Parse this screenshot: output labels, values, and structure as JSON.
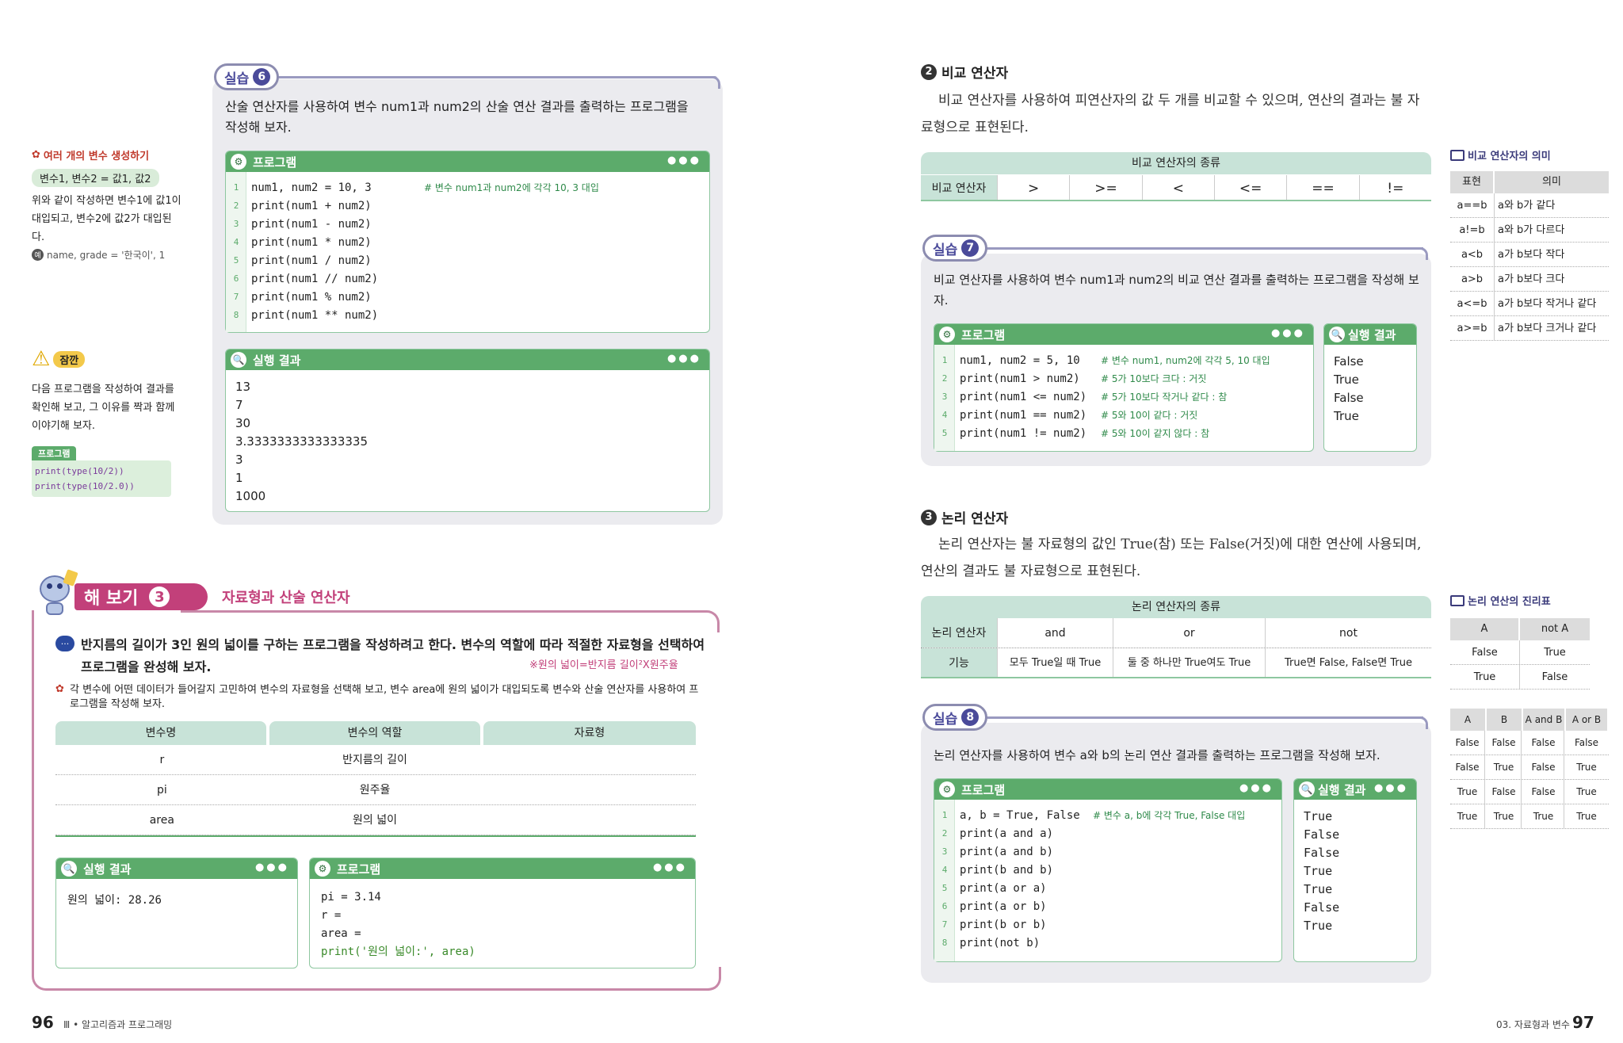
{
  "left_page": {
    "page_number": "96",
    "footer": "Ⅲ • 알고리즘과 프로그래밍",
    "sidebar_tip": {
      "title": "여러 개의 변수 생성하기",
      "syntax": "변수1, 변수2 = 값1, 값2",
      "text": "위와 같이 작성하면 변수1에 값1이 대입되고, 변수2에 값2가 대입된다.",
      "example_label": "예",
      "example": "name, grade = '한국이', 1"
    },
    "sidebar_wait": {
      "title": "잠깐",
      "text": "다음 프로그램을 작성하여 결과를 확인해 보고, 그 이유를 짝과 함께 이야기해 보자.",
      "program_label": "프로그램",
      "code": [
        "print(type(10/2))",
        "print(type(10/2.0))"
      ]
    },
    "practice6": {
      "tag": "실습",
      "num": "6",
      "description": "산술 연산자를 사용하여 변수 num1과 num2의 산술 연산 결과를 출력하는 프로그램을 작성해 보자.",
      "program_label": "프로그램",
      "code": [
        {
          "n": "1",
          "text": "num1, num2 = 10, 3",
          "comment": "# 변수 num1과 num2에 각각 10, 3 대입"
        },
        {
          "n": "2",
          "text": "print(num1 + num2)",
          "comment": ""
        },
        {
          "n": "3",
          "text": "print(num1 - num2)",
          "comment": ""
        },
        {
          "n": "4",
          "text": "print(num1 * num2)",
          "comment": ""
        },
        {
          "n": "5",
          "text": "print(num1 / num2)",
          "comment": ""
        },
        {
          "n": "6",
          "text": "print(num1 // num2)",
          "comment": ""
        },
        {
          "n": "7",
          "text": "print(num1 % num2)",
          "comment": ""
        },
        {
          "n": "8",
          "text": "print(num1 ** num2)",
          "comment": ""
        }
      ],
      "result_label": "실행 결과",
      "result": [
        "13",
        "7",
        "30",
        "3.3333333333333335",
        "3",
        "1",
        "1000"
      ]
    },
    "tryit": {
      "label": "해 보기",
      "num": "3",
      "title": "자료형과 산술 연산자",
      "question": "반지름의 길이가 3인 원의 넓이를 구하는 프로그램을 작성하려고 한다. 변수의 역할에 따라 적절한 자료형을 선택하여 프로그램을 완성해 보자.",
      "note": "※원의 넓이=반지름 길이²X원주율",
      "instruction": "각 변수에 어떤 데이터가 들어갈지 고민하여 변수의 자료형을 선택해 보고, 변수 area에 원의 넓이가 대입되도록 변수와 산술 연산자를 사용하여 프로그램을 작성해 보자.",
      "table_headers": [
        "변수명",
        "변수의 역할",
        "자료형"
      ],
      "table_rows": [
        [
          "r",
          "반지름의 길이",
          ""
        ],
        [
          "pi",
          "원주율",
          ""
        ],
        [
          "area",
          "원의 넓이",
          ""
        ]
      ],
      "result_label": "실행 결과",
      "result": "원의 넓이: 28.26",
      "program_label": "프로그램",
      "code": [
        "pi = 3.14",
        "r =",
        "area =",
        "print('원의 넓이:', area)"
      ]
    }
  },
  "right_page": {
    "page_number": "97",
    "footer": "03. 자료형과 변수",
    "comparison": {
      "num": "2",
      "title": "비교 연산자",
      "paragraph": "비교 연산자를 사용하여 피연산자의 값 두 개를 비교할 수 있으며, 연산의 결과는 불 자료형으로 표현된다.",
      "table_title": "비교 연산자의 종류",
      "row_label": "비교 연산자",
      "operators": [
        ">",
        ">=",
        "<",
        "<=",
        "==",
        "!="
      ]
    },
    "practice7": {
      "tag": "실습",
      "num": "7",
      "description": "비교 연산자를 사용하여 변수 num1과 num2의 비교 연산 결과를 출력하는 프로그램을 작성해 보자.",
      "program_label": "프로그램",
      "code": [
        {
          "n": "1",
          "text": "num1, num2 = 5, 10",
          "comment": "# 변수 num1, num2에 각각 5, 10 대입"
        },
        {
          "n": "2",
          "text": "print(num1 > num2)",
          "comment": "# 5가 10보다 크다 : 거짓"
        },
        {
          "n": "3",
          "text": "print(num1 <= num2)",
          "comment": "# 5가 10보다 작거나 같다 : 참"
        },
        {
          "n": "4",
          "text": "print(num1 == num2)",
          "comment": "# 5와 10이 같다 : 거짓"
        },
        {
          "n": "5",
          "text": "print(num1 != num2)",
          "comment": "# 5와 10이 같지 않다 : 참"
        }
      ],
      "result_label": "실행 결과",
      "result": [
        "False",
        "True",
        "False",
        "True"
      ]
    },
    "logical": {
      "num": "3",
      "title": "논리 연산자",
      "paragraph": "논리 연산자는 불 자료형의 값인 True(참) 또는 False(거짓)에 대한 연산에 사용되며, 연산의 결과도 불 자료형으로 표현된다.",
      "table_title": "논리 연산자의 종류",
      "row1_label": "논리 연산자",
      "row2_label": "기능",
      "ops": [
        "and",
        "or",
        "not"
      ],
      "functions": [
        "모두 True일 때 True",
        "둘 중 하나만 True여도 True",
        "True면 False, False면 True"
      ]
    },
    "practice8": {
      "tag": "실습",
      "num": "8",
      "description": "논리 연산자를 사용하여 변수 a와 b의 논리 연산 결과를 출력하는 프로그램을 작성해 보자.",
      "program_label": "프로그램",
      "code": [
        {
          "n": "1",
          "text": "a, b = True, False",
          "comment": "# 변수 a, b에 각각 True, False 대입"
        },
        {
          "n": "2",
          "text": "print(a and a)",
          "comment": ""
        },
        {
          "n": "3",
          "text": "print(a and b)",
          "comment": ""
        },
        {
          "n": "4",
          "text": "print(b and b)",
          "comment": ""
        },
        {
          "n": "5",
          "text": "print(a or a)",
          "comment": ""
        },
        {
          "n": "6",
          "text": "print(a or b)",
          "comment": ""
        },
        {
          "n": "7",
          "text": "print(b or b)",
          "comment": ""
        },
        {
          "n": "8",
          "text": "print(not b)",
          "comment": ""
        }
      ],
      "result_label": "실행 결과",
      "result": [
        "True",
        "False",
        "False",
        "True",
        "True",
        "False",
        "True"
      ]
    },
    "side_comparison": {
      "title": "비교 연산자의 의미",
      "headers": [
        "표현",
        "의미"
      ],
      "rows": [
        [
          "a==b",
          "a와 b가 같다"
        ],
        [
          "a!=b",
          "a와 b가 다르다"
        ],
        [
          "a<b",
          "a가 b보다 작다"
        ],
        [
          "a>b",
          "a가 b보다 크다"
        ],
        [
          "a<=b",
          "a가 b보다 작거나 같다"
        ],
        [
          "a>=b",
          "a가 b보다 크거나 같다"
        ]
      ]
    },
    "side_truth": {
      "title": "논리 연산의 진리표",
      "not_headers": [
        "A",
        "not A"
      ],
      "not_rows": [
        [
          "False",
          "True"
        ],
        [
          "True",
          "False"
        ]
      ],
      "headers": [
        "A",
        "B",
        "A and B",
        "A or B"
      ],
      "rows": [
        [
          "False",
          "False",
          "False",
          "False"
        ],
        [
          "False",
          "True",
          "False",
          "True"
        ],
        [
          "True",
          "False",
          "False",
          "True"
        ],
        [
          "True",
          "True",
          "True",
          "True"
        ]
      ]
    }
  }
}
